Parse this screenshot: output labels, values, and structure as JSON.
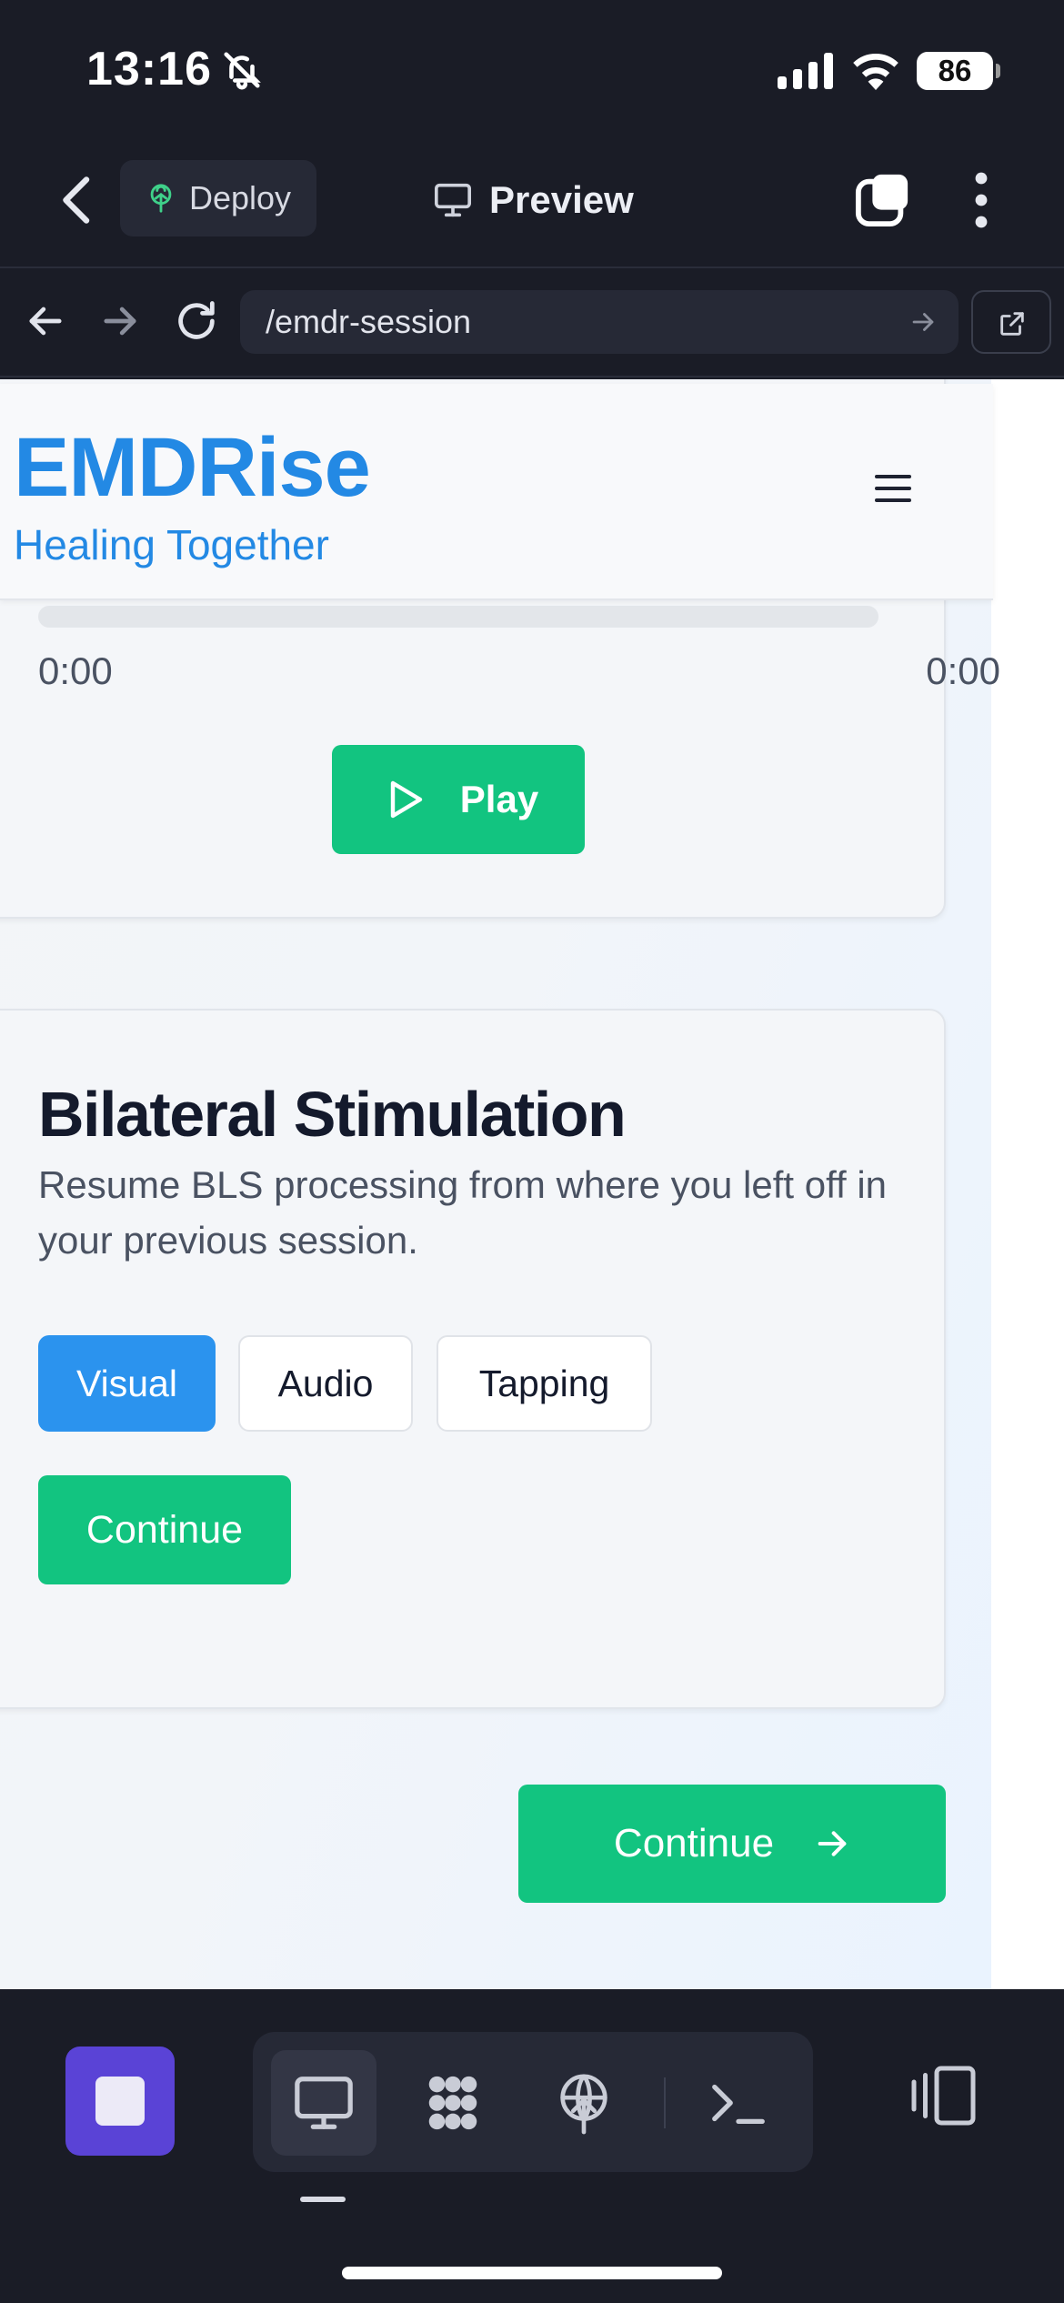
{
  "status_bar": {
    "time": "13:16",
    "battery": "86"
  },
  "toolbar": {
    "deploy_label": "Deploy",
    "preview_label": "Preview"
  },
  "urlbar": {
    "url": "/emdr-session"
  },
  "site": {
    "brand": "EMDRise",
    "tagline": "Healing Together"
  },
  "audio_player": {
    "time_current": "0:00",
    "time_total": "0:00",
    "progress": 0,
    "play_label": "Play"
  },
  "bls": {
    "title": "Bilateral Stimulation",
    "description": "Resume BLS processing from where you left off in your previous session.",
    "modes": [
      "Visual",
      "Audio",
      "Tapping"
    ],
    "selected_mode": "Visual",
    "continue_label": "Continue"
  },
  "footer": {
    "continue_label": "Continue"
  },
  "colors": {
    "brand_blue": "#2389e4",
    "accent_green": "#12c480",
    "selected_blue": "#2b93ee",
    "dock_purple": "#5a43d6"
  },
  "icons": {
    "status": [
      "bell-off-icon",
      "signal-icon",
      "wifi-icon",
      "battery-icon"
    ],
    "toolbar": [
      "chevron-left-icon",
      "deploy-tree-icon",
      "monitor-icon",
      "tabs-icon",
      "more-vertical-icon"
    ],
    "urlbar": [
      "arrow-left-icon",
      "arrow-right-icon",
      "reload-icon",
      "arrow-go-icon",
      "external-link-icon"
    ],
    "dock": [
      "stop-icon",
      "monitor-icon",
      "grid-icon",
      "deploy-icon",
      "terminal-icon",
      "panel-icon"
    ]
  }
}
